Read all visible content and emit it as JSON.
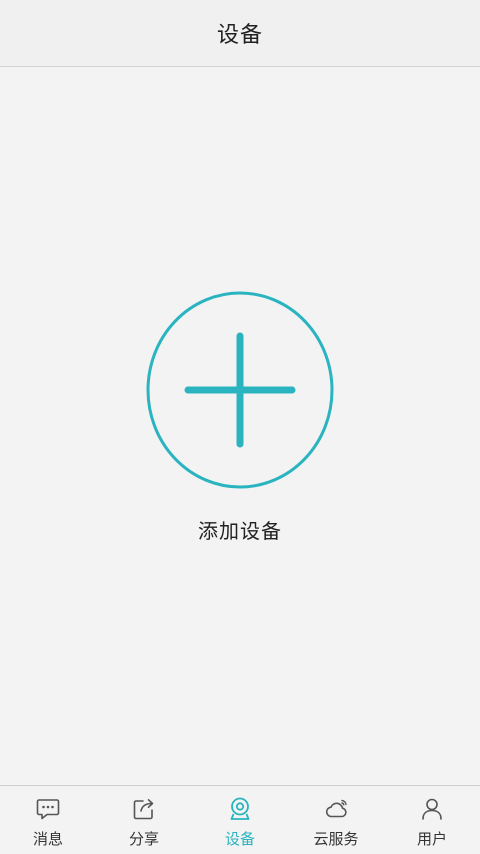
{
  "header": {
    "title": "设备"
  },
  "main": {
    "add_label": "添加设备",
    "accent_color": "#2ab4c0",
    "add_icon": "plus-icon"
  },
  "tabs": [
    {
      "label": "消息",
      "icon": "message-icon",
      "active": false
    },
    {
      "label": "分享",
      "icon": "share-icon",
      "active": false
    },
    {
      "label": "设备",
      "icon": "camera-icon",
      "active": true
    },
    {
      "label": "云服务",
      "icon": "cloud-icon",
      "active": false
    },
    {
      "label": "用户",
      "icon": "user-icon",
      "active": false
    }
  ]
}
